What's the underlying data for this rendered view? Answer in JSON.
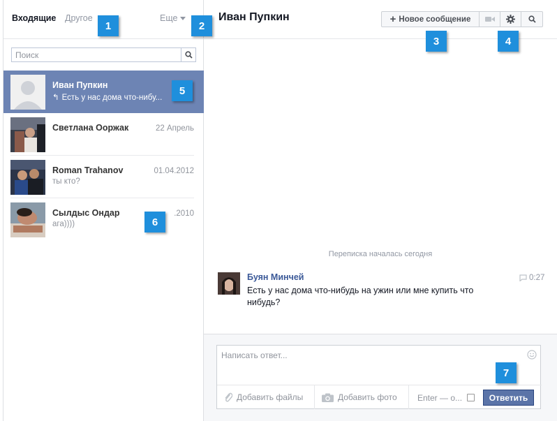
{
  "sidebar": {
    "tabs": {
      "inbox": "Входящие",
      "other": "Другое"
    },
    "more_label": "Еще",
    "search": {
      "placeholder": "Поиск"
    },
    "threads": [
      {
        "name": "Иван Пупкин",
        "snippet": "Есть у нас дома что-нибу...",
        "date": "",
        "active": true
      },
      {
        "name": "Светлана Ооржак",
        "snippet": "",
        "date": "22 Апрель"
      },
      {
        "name": "Roman Trahanov",
        "snippet": "ты кто?",
        "date": "01.04.2012"
      },
      {
        "name": "Сылдыс Ондар",
        "snippet": "ага))))",
        "date": ".2010"
      }
    ]
  },
  "conversation": {
    "title": "Иван Пупкин",
    "toolbar": {
      "new_message": "Новое сообщение"
    },
    "started_label": "Переписка началась сегодня",
    "message": {
      "author": "Буян Минчей",
      "text": "Есть у нас дома что-нибудь на ужин или мне купить что нибудь?",
      "time": "0:27"
    }
  },
  "composer": {
    "placeholder": "Написать ответ...",
    "attach_files": "Добавить файлы",
    "attach_photo": "Добавить фото",
    "enter_label": "Enter — о...",
    "send": "Ответить"
  },
  "callouts": [
    "1",
    "2",
    "3",
    "4",
    "5",
    "6",
    "7"
  ],
  "colors": {
    "active_thread": "#6d84b4",
    "send_button": "#5b74a8",
    "callout": "#1f8fdc"
  }
}
